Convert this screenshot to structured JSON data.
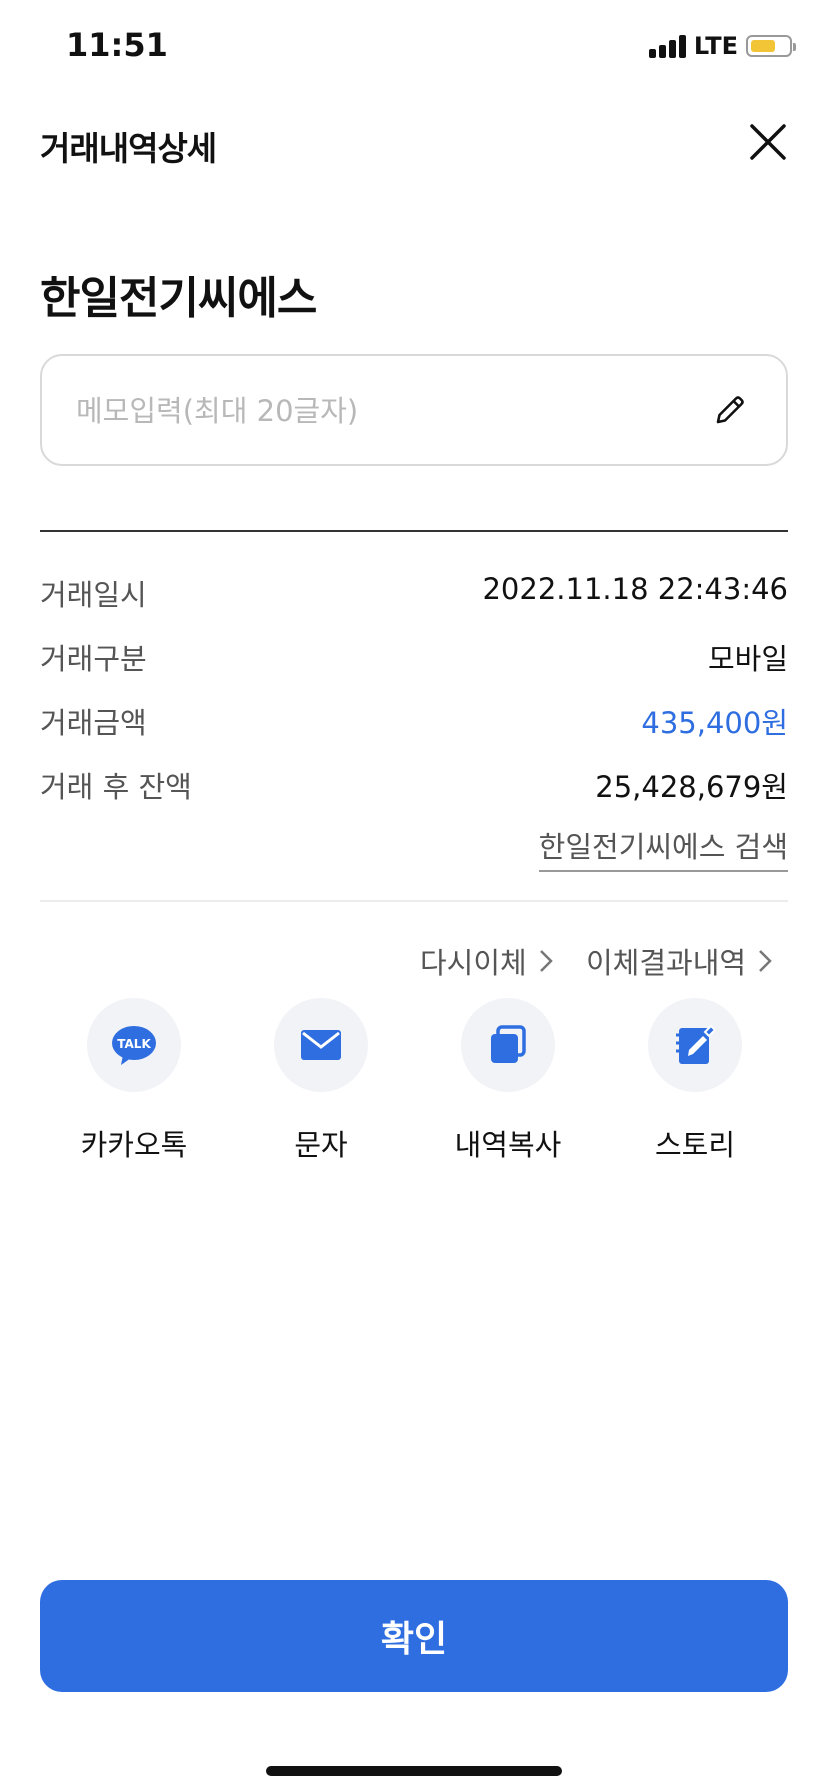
{
  "status_bar": {
    "time": "11:51",
    "network": "LTE"
  },
  "header": {
    "title": "거래내역상세"
  },
  "merchant": "한일전기씨에스",
  "memo": {
    "placeholder": "메모입력(최대 20글자)",
    "value": ""
  },
  "details": [
    {
      "label": "거래일시",
      "value": "2022.11.18 22:43:46"
    },
    {
      "label": "거래구분",
      "value": "모바일"
    },
    {
      "label": "거래금액",
      "value": "435,400원"
    },
    {
      "label": "거래 후 잔액",
      "value": "25,428,679원"
    }
  ],
  "search_link": "한일전기씨에스 검색",
  "links": {
    "retransfer": "다시이체",
    "transfer_history": "이체결과내역"
  },
  "actions": [
    {
      "label": "카카오톡",
      "icon": "talk-icon",
      "badge": "TALK"
    },
    {
      "label": "문자",
      "icon": "mail-icon"
    },
    {
      "label": "내역복사",
      "icon": "copy-icon"
    },
    {
      "label": "스토리",
      "icon": "notebook-edit-icon"
    }
  ],
  "confirm_label": "확인",
  "colors": {
    "accent": "#2f6ee0",
    "battery": "#f2c537"
  }
}
